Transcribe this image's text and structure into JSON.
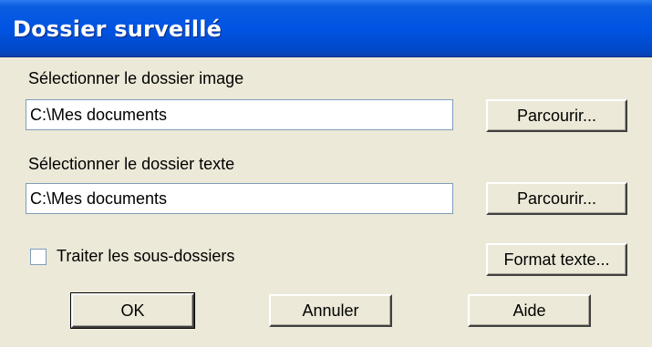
{
  "window": {
    "title": "Dossier surveillé"
  },
  "image_folder": {
    "label": "Sélectionner le dossier image",
    "value": "C:\\Mes documents",
    "browse_label": "Parcourir..."
  },
  "text_folder": {
    "label": "Sélectionner le dossier texte",
    "value": "C:\\Mes documents",
    "browse_label": "Parcourir..."
  },
  "options": {
    "subfolders_label": "Traiter les sous-dossiers",
    "subfolders_checked": false,
    "format_label": "Format texte..."
  },
  "actions": {
    "ok_label": "OK",
    "cancel_label": "Annuler",
    "help_label": "Aide"
  }
}
